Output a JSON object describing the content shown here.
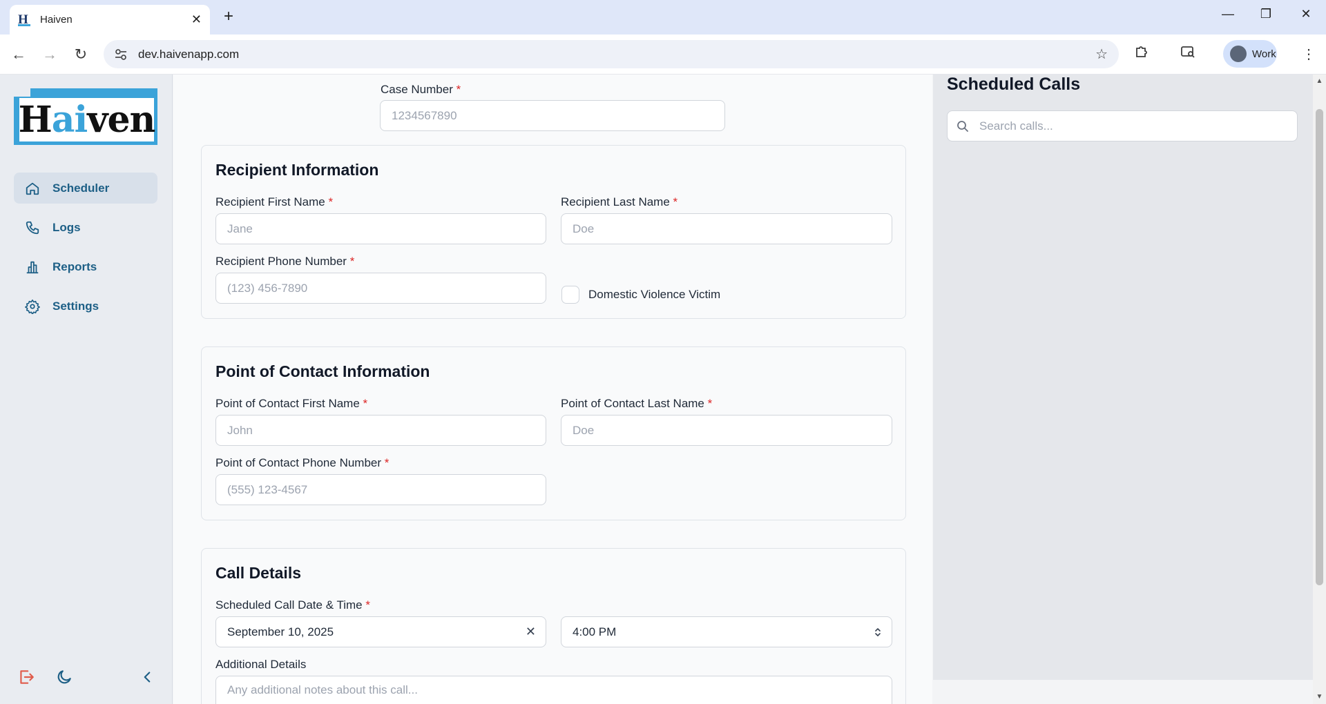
{
  "browser": {
    "tab_title": "Haiven",
    "tab_favicon_letter": "H",
    "url": "dev.haivenapp.com",
    "profile_label": "Work"
  },
  "sidebar": {
    "logo": {
      "text_pre": "H",
      "text_ai": "ai",
      "text_post": "ven"
    },
    "items": [
      {
        "label": "Scheduler",
        "icon": "home-icon",
        "active": true
      },
      {
        "label": "Logs",
        "icon": "phone-icon",
        "active": false
      },
      {
        "label": "Reports",
        "icon": "bar-chart-icon",
        "active": false
      },
      {
        "label": "Settings",
        "icon": "gear-icon",
        "active": false
      }
    ]
  },
  "form": {
    "case_number": {
      "label": "Case Number",
      "required": "*",
      "placeholder": "1234567890"
    },
    "recipient": {
      "title": "Recipient Information",
      "first_name": {
        "label": "Recipient First Name",
        "required": "*",
        "placeholder": "Jane"
      },
      "last_name": {
        "label": "Recipient Last Name",
        "required": "*",
        "placeholder": "Doe"
      },
      "phone": {
        "label": "Recipient Phone Number",
        "required": "*",
        "placeholder": "(123) 456-7890"
      },
      "dv_checkbox_label": "Domestic Violence Victim"
    },
    "poc": {
      "title": "Point of Contact Information",
      "first_name": {
        "label": "Point of Contact First Name",
        "required": "*",
        "placeholder": "John"
      },
      "last_name": {
        "label": "Point of Contact Last Name",
        "required": "*",
        "placeholder": "Doe"
      },
      "phone": {
        "label": "Point of Contact Phone Number",
        "required": "*",
        "placeholder": "(555) 123-4567"
      }
    },
    "call": {
      "title": "Call Details",
      "datetime_label": "Scheduled Call Date & Time",
      "required": "*",
      "date_value": "September 10, 2025",
      "time_value": "4:00 PM",
      "details_label": "Additional Details",
      "details_placeholder": "Any additional notes about this call..."
    }
  },
  "scheduled": {
    "title": "Scheduled Calls",
    "search_placeholder": "Search calls..."
  },
  "colors": {
    "brand_blue": "#3ba3d9",
    "nav_text": "#1d5f86",
    "required": "#dc2626",
    "logout_icon": "#e05b4b"
  }
}
